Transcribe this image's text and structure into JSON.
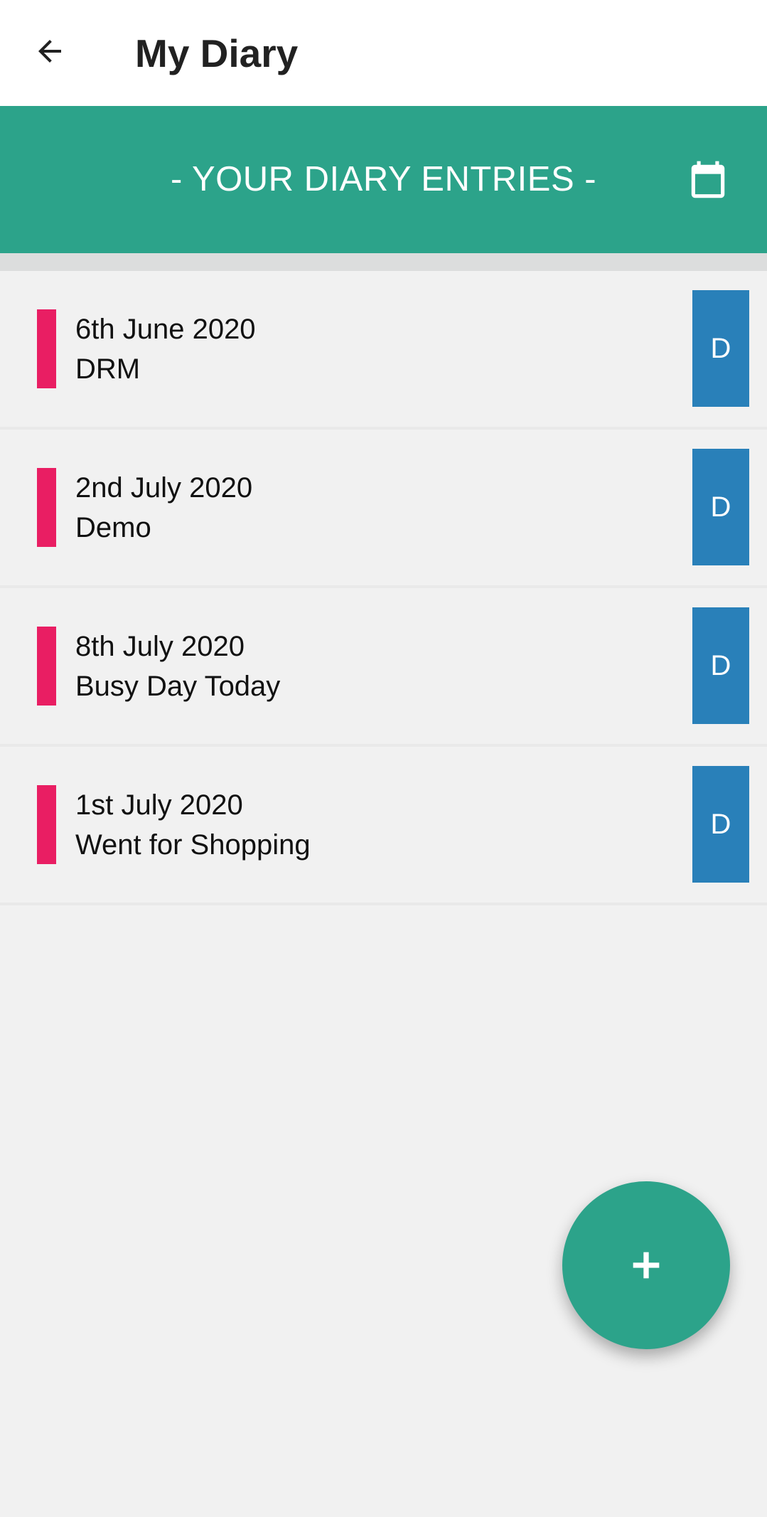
{
  "app_bar": {
    "title": "My Diary",
    "back_icon": "arrow-left-icon"
  },
  "banner": {
    "title": "- YOUR DIARY ENTRIES -",
    "calendar_icon": "calendar-icon"
  },
  "entries": [
    {
      "date": "6th June 2020",
      "title": "DRM",
      "action_label": "D"
    },
    {
      "date": "2nd July 2020",
      "title": "Demo",
      "action_label": "D"
    },
    {
      "date": "8th July 2020",
      "title": "Busy Day Today",
      "action_label": "D"
    },
    {
      "date": "1st July 2020",
      "title": "Went for Shopping",
      "action_label": "D"
    }
  ],
  "fab": {
    "icon": "plus-icon"
  },
  "colors": {
    "primary": "#2ca38a",
    "accent": "#e91e63",
    "action": "#2980b9",
    "background": "#f1f1f1"
  }
}
